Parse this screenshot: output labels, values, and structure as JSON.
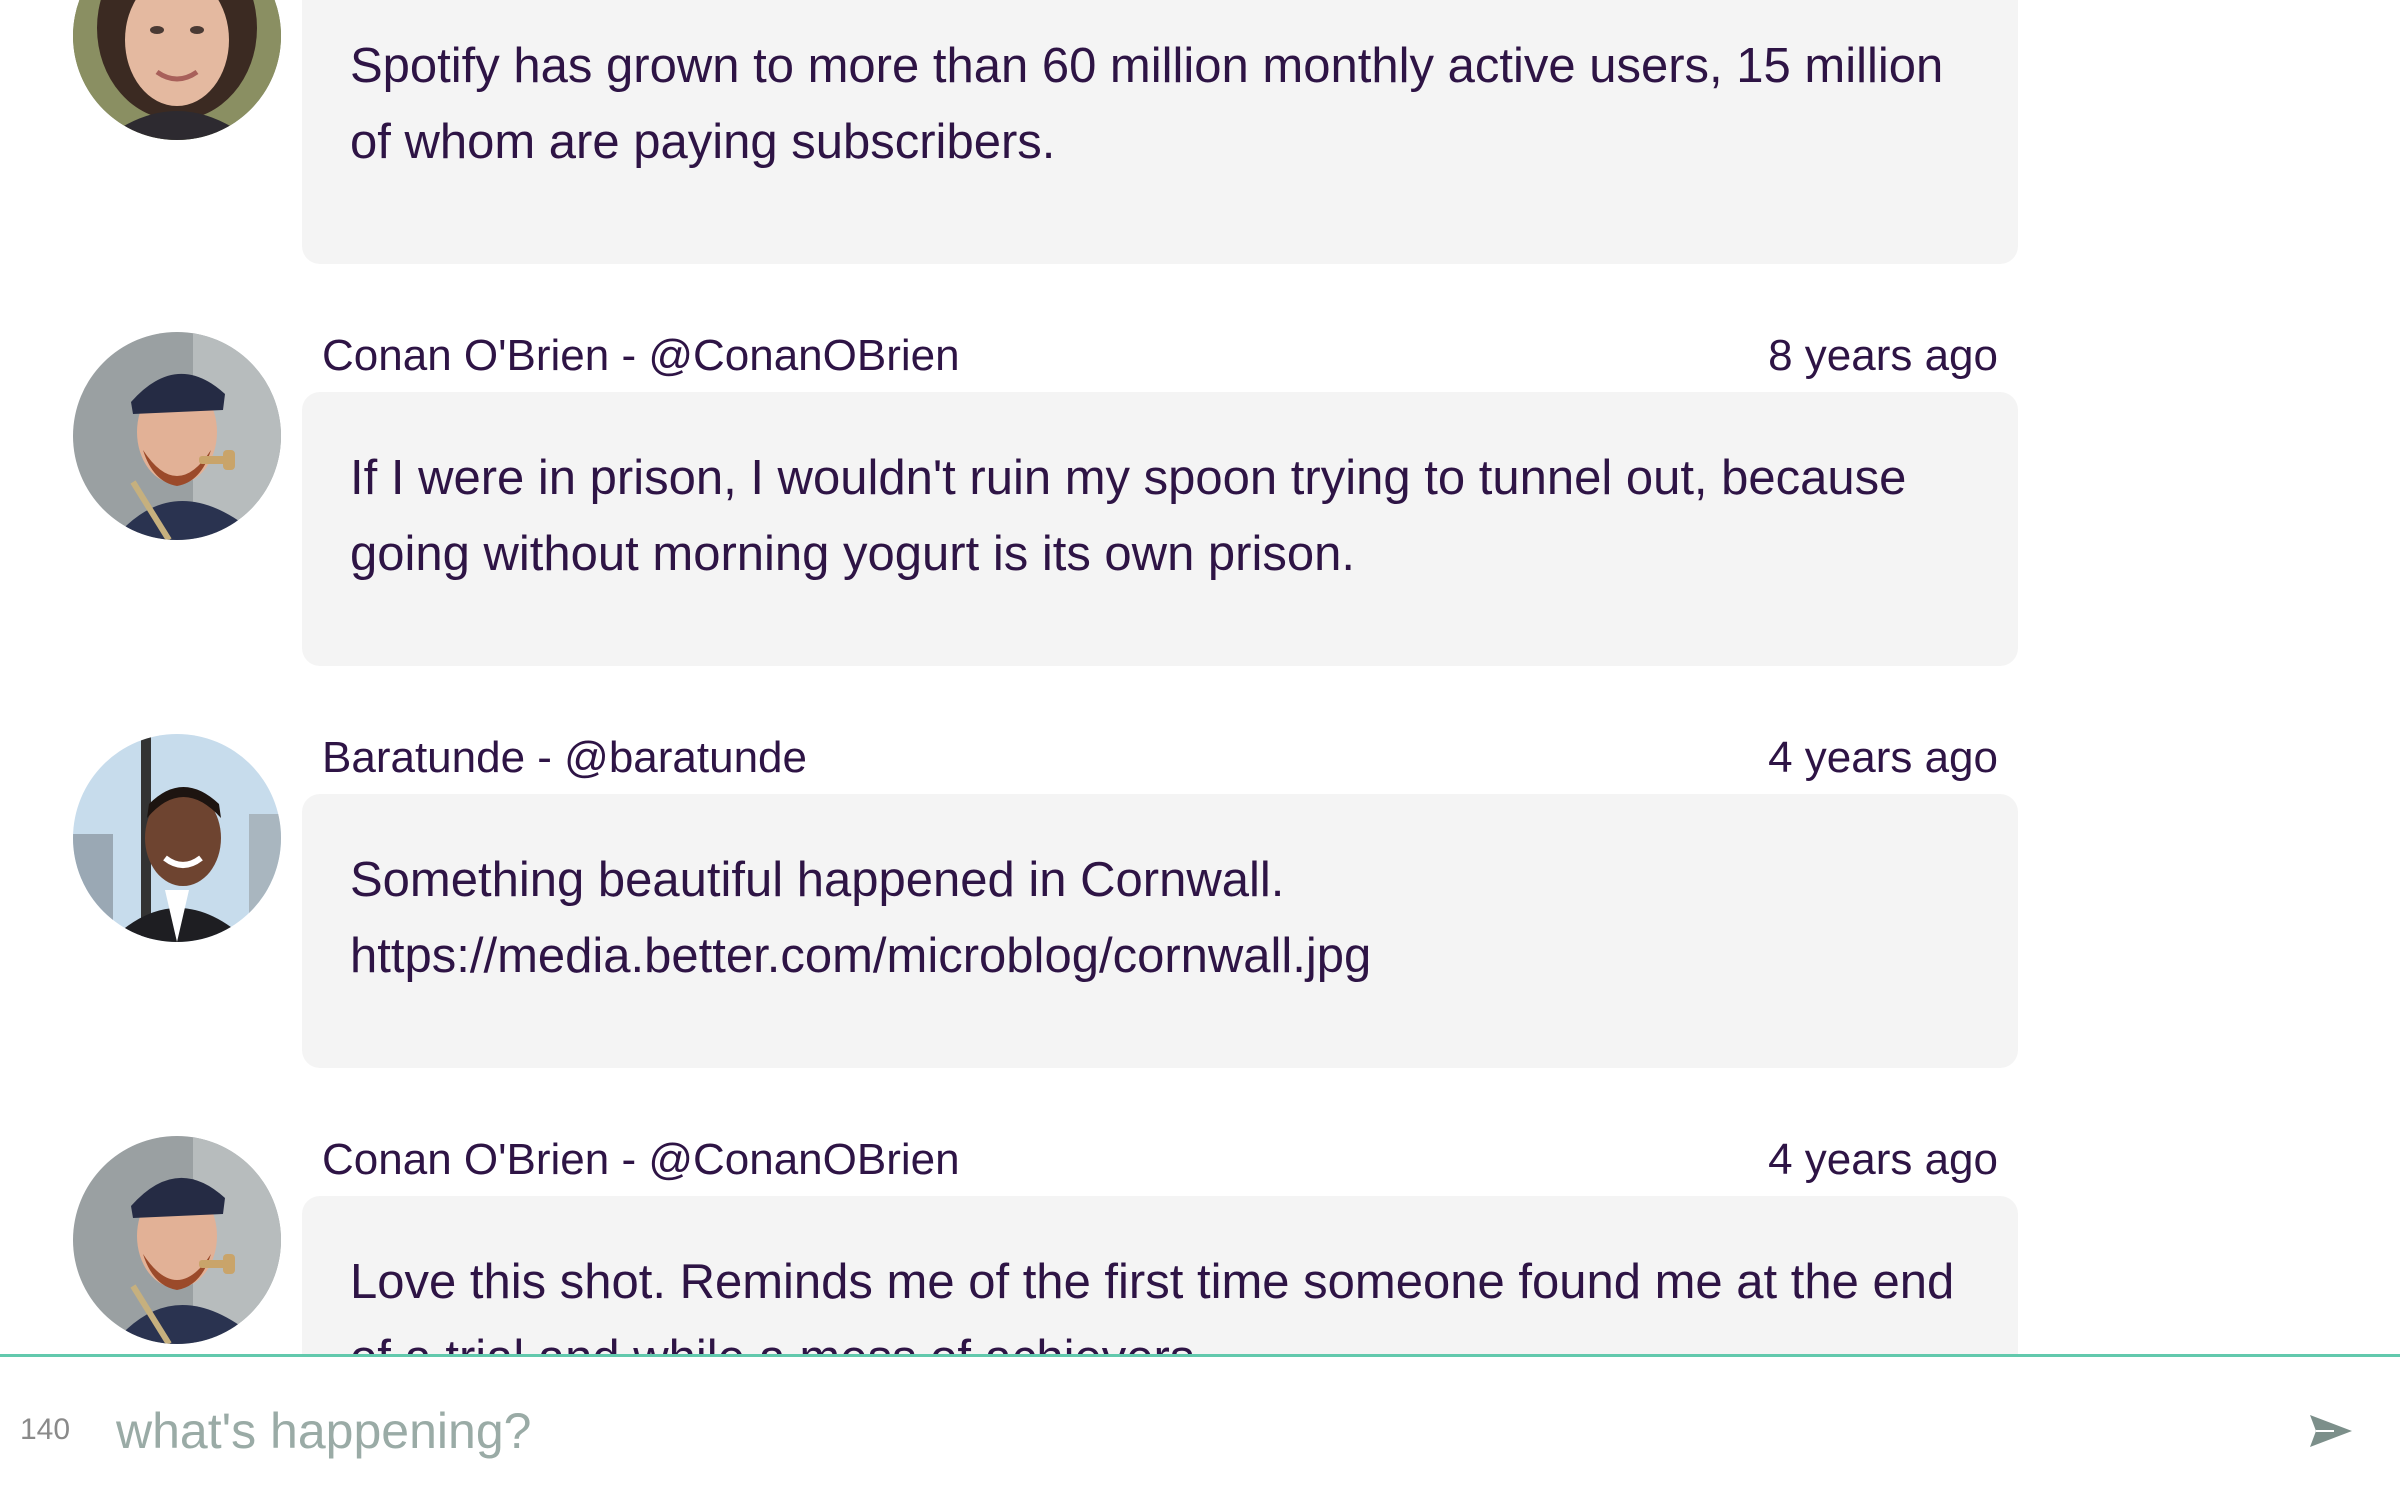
{
  "feed": {
    "posts": [
      {
        "author": "",
        "time": "",
        "text": "Spotify has grown to more than 60 million monthly active users, 15 million of whom are paying subscribers."
      },
      {
        "author": "Conan O'Brien - @ConanOBrien",
        "time": "8 years ago",
        "text": "If I were in prison, I wouldn't ruin my spoon trying to tunnel out, because going without morning yogurt is its own prison."
      },
      {
        "author": "Baratunde - @baratunde",
        "time": "4 years ago",
        "text": "Something beautiful happened in Cornwall. https://media.better.com/microblog/cornwall.jpg"
      },
      {
        "author": "Conan O'Brien - @ConanOBrien",
        "time": "4 years ago",
        "text": "Love this shot. Reminds me of the first time someone found me at the end of a trial and while a mess of achievers."
      }
    ]
  },
  "composer": {
    "counter": "140",
    "placeholder": "what's happening?",
    "value": "",
    "send_icon": "send-icon"
  },
  "colors": {
    "text": "#2e1445",
    "bubble": "#f4f4f4",
    "accent": "#62c9ad",
    "placeholder": "#9aaba6"
  }
}
